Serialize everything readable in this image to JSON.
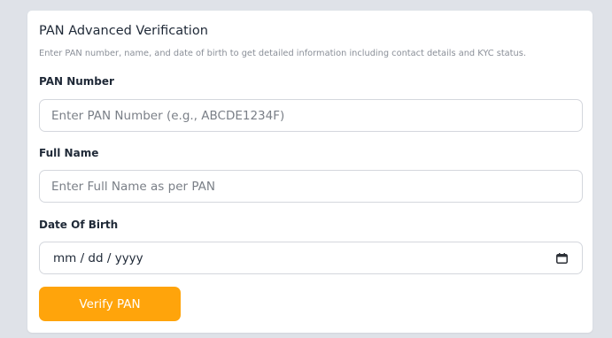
{
  "form": {
    "title": "PAN Advanced Verification",
    "subtitle": "Enter PAN number, name, and date of birth to get detailed information including contact details and KYC status.",
    "pan_label": "PAN Number",
    "pan_placeholder": "Enter PAN Number (e.g., ABCDE1234F)",
    "name_label": "Full Name",
    "name_placeholder": "Enter Full Name as per PAN",
    "dob_label": "Date Of Birth",
    "dob_value": "mm / dd / yyyy",
    "dob_icon": "calendar-icon",
    "submit_label": "Verify PAN"
  },
  "colors": {
    "accent": "#ffa40b",
    "background": "#dfe2e8",
    "card": "#ffffff",
    "border": "#d4d7dd"
  }
}
